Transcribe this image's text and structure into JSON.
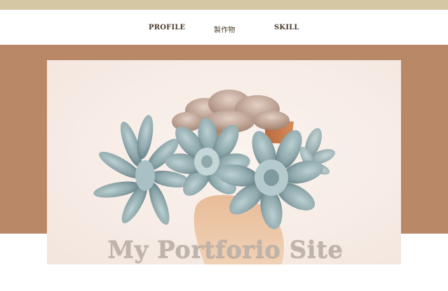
{
  "header": {
    "accent_color": "#d5c7a3",
    "nav": [
      {
        "label": "PROFILE"
      },
      {
        "label": "製作物"
      },
      {
        "label": "SKILL"
      }
    ]
  },
  "hero": {
    "band_color": "#b98967",
    "image_subject": "succulent-plant-photo",
    "title": "My Portforio Site"
  }
}
